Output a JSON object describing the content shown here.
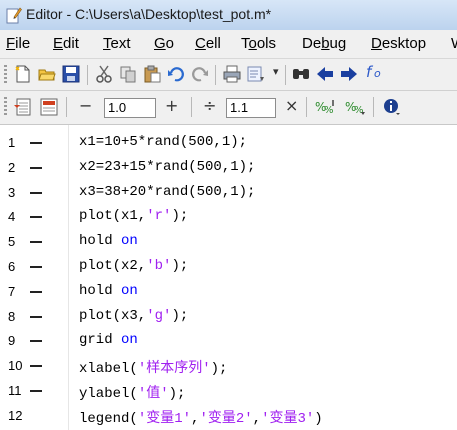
{
  "window": {
    "title": "Editor - C:\\Users\\a\\Desktop\\test_pot.m*"
  },
  "menu": [
    {
      "label": "File"
    },
    {
      "label": "Edit"
    },
    {
      "label": "Text"
    },
    {
      "label": "Go"
    },
    {
      "label": "Cell"
    },
    {
      "label": "Tools"
    },
    {
      "label": "Debug"
    },
    {
      "label": "Desktop"
    },
    {
      "label": "W"
    }
  ],
  "toolbar1": {
    "icons": [
      "new-file-icon",
      "open-folder-icon",
      "save-icon",
      "cut-icon",
      "copy-icon",
      "paste-icon",
      "undo-icon",
      "redo-icon",
      "print-icon",
      "comment-icon",
      "dropdown-icon",
      "find-icon",
      "back-arrow-icon",
      "forward-arrow-icon",
      "function-icon"
    ],
    "colors": {
      "save": "#2a4fa8",
      "cut": "#555555",
      "find": "#444444",
      "arrows": "#1a3fa0",
      "fx": "#2c59c9"
    }
  },
  "toolbar2": {
    "minus": "−",
    "increment_value": "1.0",
    "plus": "+",
    "divide": "÷",
    "scale_value": "1.1",
    "times": "×",
    "tooltip_icons": [
      "cell-eval-icon",
      "cell-eval-advance-icon",
      "cell-mode-info-icon"
    ]
  },
  "editor": {
    "lines": [
      {
        "n": "1",
        "parts": [
          {
            "t": "x1=10+5*rand(500,1);",
            "c": "plain"
          }
        ]
      },
      {
        "n": "2",
        "parts": [
          {
            "t": "x2=23+15*rand(500,1);",
            "c": "plain"
          }
        ]
      },
      {
        "n": "3",
        "parts": [
          {
            "t": "x3=38+20*rand(500,1);",
            "c": "plain"
          }
        ]
      },
      {
        "n": "4",
        "parts": [
          {
            "t": "plot(x1,",
            "c": "plain"
          },
          {
            "t": "'r'",
            "c": "str"
          },
          {
            "t": ");",
            "c": "plain"
          }
        ]
      },
      {
        "n": "5",
        "parts": [
          {
            "t": "hold ",
            "c": "plain"
          },
          {
            "t": "on",
            "c": "kw"
          }
        ]
      },
      {
        "n": "6",
        "parts": [
          {
            "t": "plot(x2,",
            "c": "plain"
          },
          {
            "t": "'b'",
            "c": "str"
          },
          {
            "t": ");",
            "c": "plain"
          }
        ]
      },
      {
        "n": "7",
        "parts": [
          {
            "t": "hold ",
            "c": "plain"
          },
          {
            "t": "on",
            "c": "kw"
          }
        ]
      },
      {
        "n": "8",
        "parts": [
          {
            "t": "plot(x3,",
            "c": "plain"
          },
          {
            "t": "'g'",
            "c": "str"
          },
          {
            "t": ");",
            "c": "plain"
          }
        ]
      },
      {
        "n": "9",
        "parts": [
          {
            "t": "grid ",
            "c": "plain"
          },
          {
            "t": "on",
            "c": "kw"
          }
        ]
      },
      {
        "n": "10",
        "parts": [
          {
            "t": "xlabel(",
            "c": "plain"
          },
          {
            "t": "'样本序列'",
            "c": "str"
          },
          {
            "t": ");",
            "c": "plain"
          }
        ]
      },
      {
        "n": "11",
        "parts": [
          {
            "t": "ylabel(",
            "c": "plain"
          },
          {
            "t": "'值'",
            "c": "str"
          },
          {
            "t": ");",
            "c": "plain"
          }
        ]
      },
      {
        "n": "12",
        "parts": [
          {
            "t": "legend(",
            "c": "plain"
          },
          {
            "t": "'变量1'",
            "c": "str"
          },
          {
            "t": ",",
            "c": "plain"
          },
          {
            "t": "'变量2'",
            "c": "str"
          },
          {
            "t": ",",
            "c": "plain"
          },
          {
            "t": "'变量3'",
            "c": "str"
          },
          {
            "t": ")",
            "c": "plain"
          }
        ]
      }
    ],
    "colors": {
      "keyword": "#0000ff",
      "string": "#a020f0",
      "text": "#000000"
    }
  }
}
